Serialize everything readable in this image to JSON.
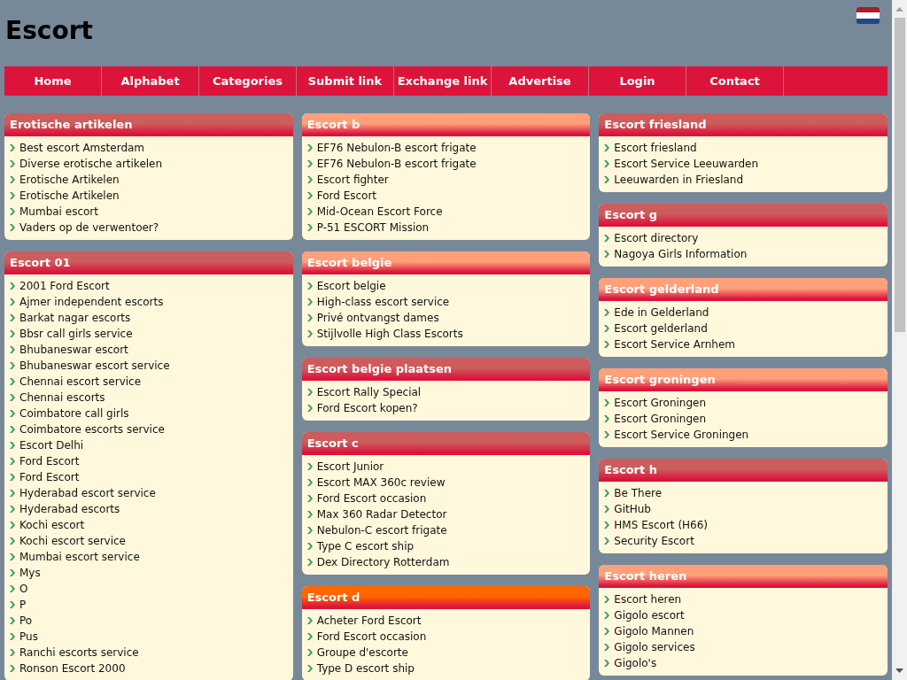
{
  "site_title": "Escort",
  "nav": [
    "Home",
    "Alphabet",
    "Categories",
    "Submit link",
    "Exchange link",
    "Advertise",
    "Login",
    "Contact"
  ],
  "columns": [
    [
      {
        "title": "Erotische artikelen",
        "color": "#cd5c5c",
        "links": [
          "Best escort Amsterdam",
          "Diverse erotische artikelen",
          "Erotische Artikelen",
          "Erotische Artikelen",
          "Mumbai escort",
          "Vaders op de verwentoer?"
        ]
      },
      {
        "title": "Escort 01",
        "color": "#cd5c5c",
        "links": [
          "2001 Ford Escort",
          "Ajmer independent escorts",
          "Barkat nagar escorts",
          "Bbsr call girls service",
          "Bhubaneswar escort",
          "Bhubaneswar escort service",
          "Chennai escort service",
          "Chennai escorts",
          "Coimbatore call girls",
          "Coimbatore escorts service",
          "Escort Delhi",
          "Ford Escort",
          "Ford Escort",
          "Hyderabad escort service",
          "Hyderabad escorts",
          "Kochi escort",
          "Kochi escort service",
          "Mumbai escort service",
          "Mys",
          "O",
          "P",
          "Po",
          "Pus",
          "Ranchi escorts service",
          "Ronson Escort 2000"
        ]
      }
    ],
    [
      {
        "title": "Escort b",
        "color": "#ffa07a",
        "links": [
          "EF76 Nebulon-B escort frigate",
          "EF76 Nebulon-B escort frigate",
          "Escort fighter",
          "Ford Escort",
          "Mid-Ocean Escort Force",
          "P-51 ESCORT Mission"
        ]
      },
      {
        "title": "Escort belgie",
        "color": "#ffa07a",
        "links": [
          "Escort belgie",
          "High-class escort service",
          "Privé ontvangst dames",
          "Stijlvolle High Class Escorts"
        ]
      },
      {
        "title": "Escort belgie plaatsen",
        "color": "#cd5c5c",
        "links": [
          "Escort Rally Special",
          "Ford Escort kopen?"
        ]
      },
      {
        "title": "Escort c",
        "color": "#cd5c5c",
        "links": [
          "Escort Junior",
          "Escort MAX 360c review",
          "Ford Escort occasion",
          "Max 360 Radar Detector",
          "Nebulon-C escort frigate",
          "Type C escort ship",
          "Dex Directory Rotterdam"
        ]
      },
      {
        "title": "Escort d",
        "color": "#ff6600",
        "links": [
          "Acheter Ford Escort",
          "Ford Escort occasion",
          "Groupe d'escorte",
          "Type D escort ship"
        ]
      }
    ],
    [
      {
        "title": "Escort friesland",
        "color": "#cd5c5c",
        "links": [
          "Escort friesland",
          "Escort Service Leeuwarden",
          "Leeuwarden in Friesland"
        ]
      },
      {
        "title": "Escort g",
        "color": "#cd5c5c",
        "links": [
          "Escort directory",
          "Nagoya Girls Information"
        ]
      },
      {
        "title": "Escort gelderland",
        "color": "#ffa07a",
        "links": [
          "Ede in Gelderland",
          "Escort gelderland",
          "Escort Service Arnhem"
        ]
      },
      {
        "title": "Escort groningen",
        "color": "#ffa07a",
        "links": [
          "Escort Groningen",
          "Escort Groningen",
          "Escort Service Groningen"
        ]
      },
      {
        "title": "Escort h",
        "color": "#cd5c5c",
        "links": [
          "Be There",
          "GitHub",
          "HMS Escort (H66)",
          "Security Escort"
        ]
      },
      {
        "title": "Escort heren",
        "color": "#ffa07a",
        "links": [
          "Escort heren",
          "Gigolo escort",
          "Gigolo Mannen",
          "Gigolo services",
          "Gigolo's"
        ]
      }
    ]
  ]
}
